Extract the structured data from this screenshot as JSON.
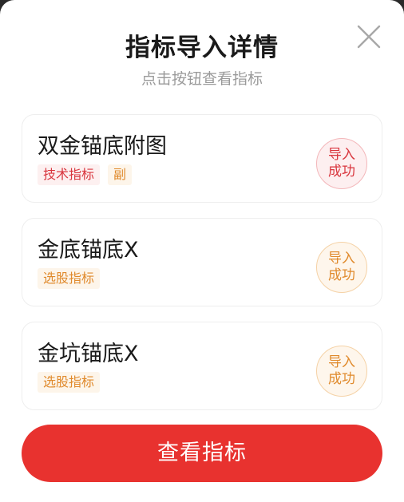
{
  "dialog": {
    "title": "指标导入详情",
    "subtitle": "点击按钮查看指标"
  },
  "close_icon": "close-icon",
  "items": [
    {
      "name": "双金锚底附图",
      "tags": [
        "技术指标",
        "副"
      ],
      "status_line1": "导入",
      "status_line2": "成功"
    },
    {
      "name": "金底锚底X",
      "tags": [
        "选股指标"
      ],
      "status_line1": "导入",
      "status_line2": "成功"
    },
    {
      "name": "金坑锚底X",
      "tags": [
        "选股指标"
      ],
      "status_line1": "导入",
      "status_line2": "成功"
    }
  ],
  "button": {
    "label": "查看指标"
  },
  "colors": {
    "accent": "#e8322f",
    "tag_red": "#d9363e",
    "tag_orange": "#e08a2c"
  }
}
